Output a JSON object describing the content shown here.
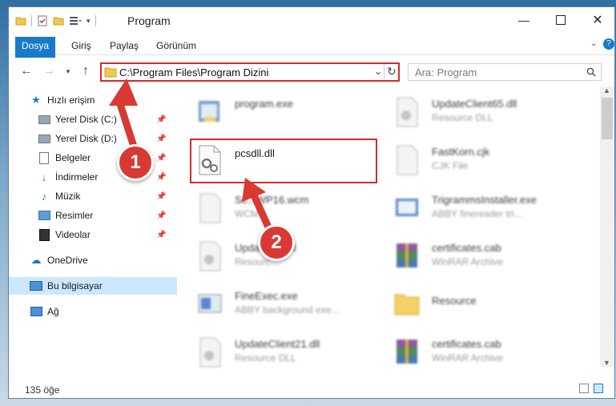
{
  "window": {
    "title": "Program",
    "tabs": [
      "Dosya",
      "Giriş",
      "Paylaş",
      "Görünüm"
    ]
  },
  "address": {
    "path": "C:\\Program Files\\Program Dizini"
  },
  "search": {
    "placeholder": "Ara: Program"
  },
  "sidebar": {
    "items": [
      {
        "label": "Hızlı erişim",
        "icon": "star-icon"
      },
      {
        "label": "Yerel Disk (C:)",
        "icon": "drive-icon"
      },
      {
        "label": "Yerel Disk (D:)",
        "icon": "drive-icon"
      },
      {
        "label": "Belgeler",
        "icon": "documents-icon"
      },
      {
        "label": "İndirmeler",
        "icon": "download-icon"
      },
      {
        "label": "Müzik",
        "icon": "music-icon"
      },
      {
        "label": "Resimler",
        "icon": "pictures-icon"
      },
      {
        "label": "Videolar",
        "icon": "videos-icon"
      },
      {
        "label": "OneDrive",
        "icon": "cloud-icon"
      },
      {
        "label": "Bu bilgisayar",
        "icon": "computer-icon"
      },
      {
        "label": "Ağ",
        "icon": "network-icon"
      }
    ]
  },
  "files": [
    {
      "name": "program.exe",
      "type": "",
      "icon": "exe-icon"
    },
    {
      "name": "UpdateClient65.dll",
      "type": "Resource DLL",
      "icon": "dll-icon"
    },
    {
      "name": "pcsdll.dll",
      "type": "",
      "icon": "dll-gear-icon"
    },
    {
      "name": "FastKorn.cjk",
      "type": "CJK File",
      "icon": "file-icon"
    },
    {
      "name": "Se...WP16.wcm",
      "type": "WCM...",
      "icon": "file-icon"
    },
    {
      "name": "TrigrammsInstaller.exe",
      "type": "ABBY finereader tri...",
      "icon": "installer-icon"
    },
    {
      "name": "Update...5.dll",
      "type": "Resourc...",
      "icon": "dll-icon"
    },
    {
      "name": "certificates.cab",
      "type": "WinRAR Archive",
      "icon": "archive-icon"
    },
    {
      "name": "FineExec.exe",
      "type": "ABBY background exe...",
      "icon": "exe-blue-icon"
    },
    {
      "name": "Resource",
      "type": "",
      "icon": "folder-icon"
    },
    {
      "name": "UpdateClient21.dll",
      "type": "Resource DLL",
      "icon": "dll-icon"
    },
    {
      "name": "certificates.cab",
      "type": "WinRAR Archive",
      "icon": "archive-icon"
    }
  ],
  "status": {
    "count": "135 öğe"
  },
  "callouts": [
    "1",
    "2"
  ],
  "colors": {
    "accent": "#1979ca",
    "highlight": "#d62a2a",
    "callout": "#d83a33"
  }
}
